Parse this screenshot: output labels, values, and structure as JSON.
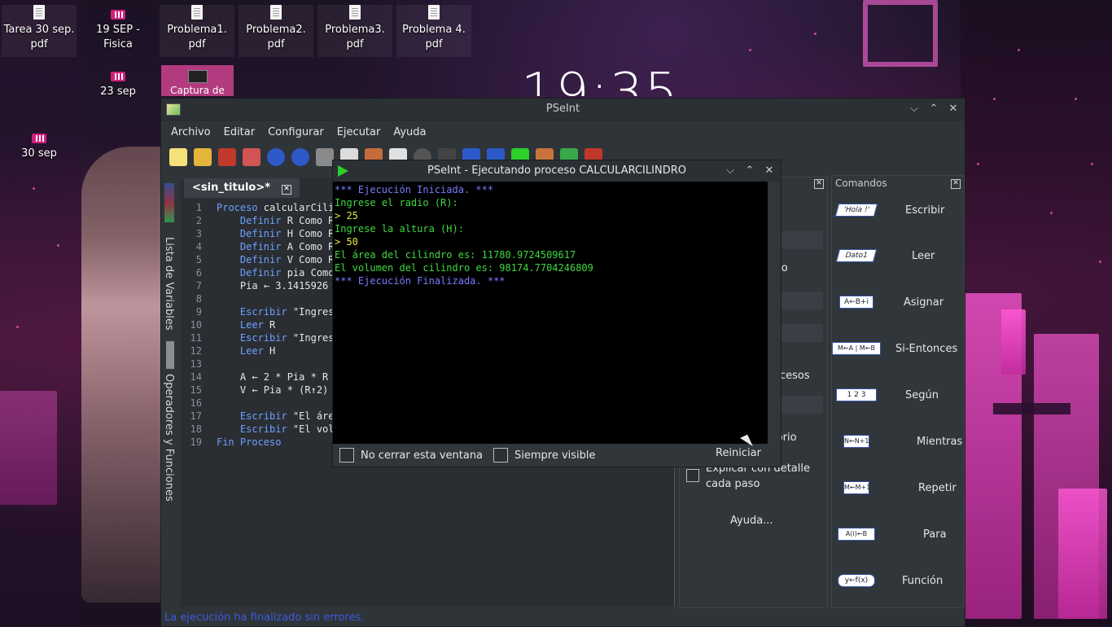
{
  "desktop": {
    "clock": "19:35",
    "icons": [
      {
        "label": "Tarea 30 sep. pdf",
        "type": "pdf"
      },
      {
        "label": "19 SEP - Fisica",
        "type": "folder"
      },
      {
        "label": "Problema1. pdf",
        "type": "pdf"
      },
      {
        "label": "Problema2. pdf",
        "type": "pdf"
      },
      {
        "label": "Problema3. pdf",
        "type": "pdf"
      },
      {
        "label": "Problema 4. pdf",
        "type": "pdf"
      },
      {
        "label": "23 sep",
        "type": "folder"
      },
      {
        "label": "30 sep",
        "type": "folder"
      },
      {
        "label": "Captura de",
        "type": "image"
      }
    ]
  },
  "main_window": {
    "title": "PSeInt",
    "menu": [
      "Archivo",
      "Editar",
      "Configurar",
      "Ejecutar",
      "Ayuda"
    ],
    "tab_label": "<sin_titulo>*",
    "side_labels": [
      "Lista de Variables",
      "Operadores y Funciones"
    ],
    "code_lines": [
      {
        "n": "1",
        "kw": "Proceso",
        "rest": " calcularCilin"
      },
      {
        "n": "2",
        "kw": "    Definir",
        "rest": " R Como Re"
      },
      {
        "n": "3",
        "kw": "    Definir",
        "rest": " H Como Re"
      },
      {
        "n": "4",
        "kw": "    Definir",
        "rest": " A Como Re"
      },
      {
        "n": "5",
        "kw": "    Definir",
        "rest": " V Como Re"
      },
      {
        "n": "6",
        "kw": "    Definir",
        "rest": " pia Como "
      },
      {
        "n": "7",
        "kw": "    ",
        "rest": "Pia ← 3.1415926"
      },
      {
        "n": "8",
        "kw": "",
        "rest": ""
      },
      {
        "n": "9",
        "kw": "    Escribir",
        "rest": " \"Ingrese"
      },
      {
        "n": "10",
        "kw": "    Leer",
        "rest": " R"
      },
      {
        "n": "11",
        "kw": "    Escribir",
        "rest": " \"Ingrese"
      },
      {
        "n": "12",
        "kw": "    Leer",
        "rest": " H"
      },
      {
        "n": "13",
        "kw": "",
        "rest": ""
      },
      {
        "n": "14",
        "kw": "    ",
        "rest": "A ← 2 * Pia * R"
      },
      {
        "n": "15",
        "kw": "    ",
        "rest": "V ← Pia * (R↑2)"
      },
      {
        "n": "16",
        "kw": "",
        "rest": ""
      },
      {
        "n": "17",
        "kw": "    Escribir",
        "rest": " \"El área"
      },
      {
        "n": "18",
        "kw": "    Escribir",
        "rest": " \"El volu"
      },
      {
        "n": "19",
        "kw": "Fin Proceso",
        "rest": ""
      }
    ],
    "status": "La ejecución ha finalizado sin errores.",
    "mid_panel": {
      "items": [
        "ar",
        "aso",
        "rocesos",
        "o",
        "itorio"
      ],
      "explain_checkbox": "Explicar con detalle cada paso",
      "help_button": "Ayuda..."
    },
    "commands_panel": {
      "header": "Comandos",
      "items": [
        {
          "label": "Escribir",
          "shape": "'Hola !'"
        },
        {
          "label": "Leer",
          "shape": "Dato1"
        },
        {
          "label": "Asignar",
          "shape": "A←B+i"
        },
        {
          "label": "Si-Entonces",
          "shape": "M←A | M←B"
        },
        {
          "label": "Según",
          "shape": "1 2 3"
        },
        {
          "label": "Mientras",
          "shape": "N←N+1"
        },
        {
          "label": "Repetir",
          "shape": "M←M+1"
        },
        {
          "label": "Para",
          "shape": "A(i)←B"
        },
        {
          "label": "Función",
          "shape": "y←f(x)"
        }
      ]
    }
  },
  "exec_window": {
    "title": "PSeInt - Ejecutando proceso CALCULARCILINDRO",
    "console": [
      {
        "text": "*** Ejecución Iniciada. ***",
        "style": "info"
      },
      {
        "text": "Ingrese el radio (R):",
        "style": "green"
      },
      {
        "text": "> 25",
        "style": "yellow"
      },
      {
        "text": "Ingrese la altura (H):",
        "style": "green"
      },
      {
        "text": "> 50",
        "style": "yellow"
      },
      {
        "text": "El área del cilindro es: 11780.9724509617",
        "style": "green"
      },
      {
        "text": "El volumen del cilindro es: 98174.7704246809",
        "style": "green"
      },
      {
        "text": "*** Ejecución Finalizada. ***",
        "style": "info"
      }
    ],
    "no_close_label": "No cerrar esta ventana",
    "always_visible_label": "Siempre visible",
    "restart_label": "Reiniciar"
  }
}
